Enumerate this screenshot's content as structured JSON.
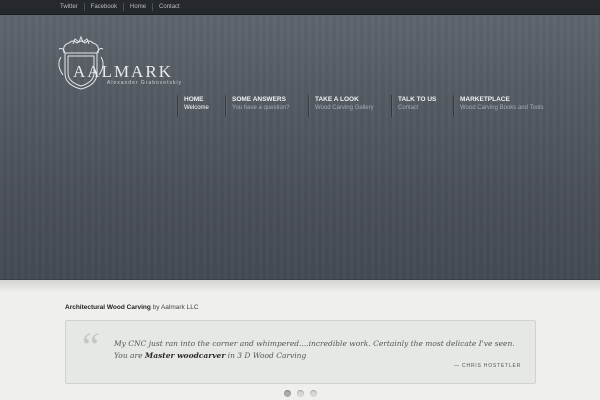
{
  "topbar": {
    "links": [
      "Twitter",
      "Facebook",
      "Home",
      "Contact"
    ]
  },
  "logo": {
    "letter": "A",
    "brand": "AALMARK",
    "tagline": "Alexander Grabovetskiy"
  },
  "nav": [
    {
      "title": "HOME",
      "subtitle": "Welcome"
    },
    {
      "title": "SOME ANSWERS",
      "subtitle": "You have a question?"
    },
    {
      "title": "TAKE A LOOK",
      "subtitle": "Wood Carving Gallery"
    },
    {
      "title": "TALK TO US",
      "subtitle": "Contact"
    },
    {
      "title": "MARKETPLACE",
      "subtitle": "Wood Carving Books and Tools"
    }
  ],
  "headline": {
    "bold": "Architectural Wood Carving",
    "rest": " by Aalmark LLC"
  },
  "testimonial": {
    "mark": "“",
    "text_before": "My CNC just ran into the corner and whimpered....incredible work. Certainly the most delicate I've seen. You are ",
    "text_bold": "Master woodcarver",
    "text_after": " in 3 D Wood Carving",
    "author": "— CHRIS HOSTETLER"
  },
  "slider": {
    "count": 3,
    "active": 0
  }
}
